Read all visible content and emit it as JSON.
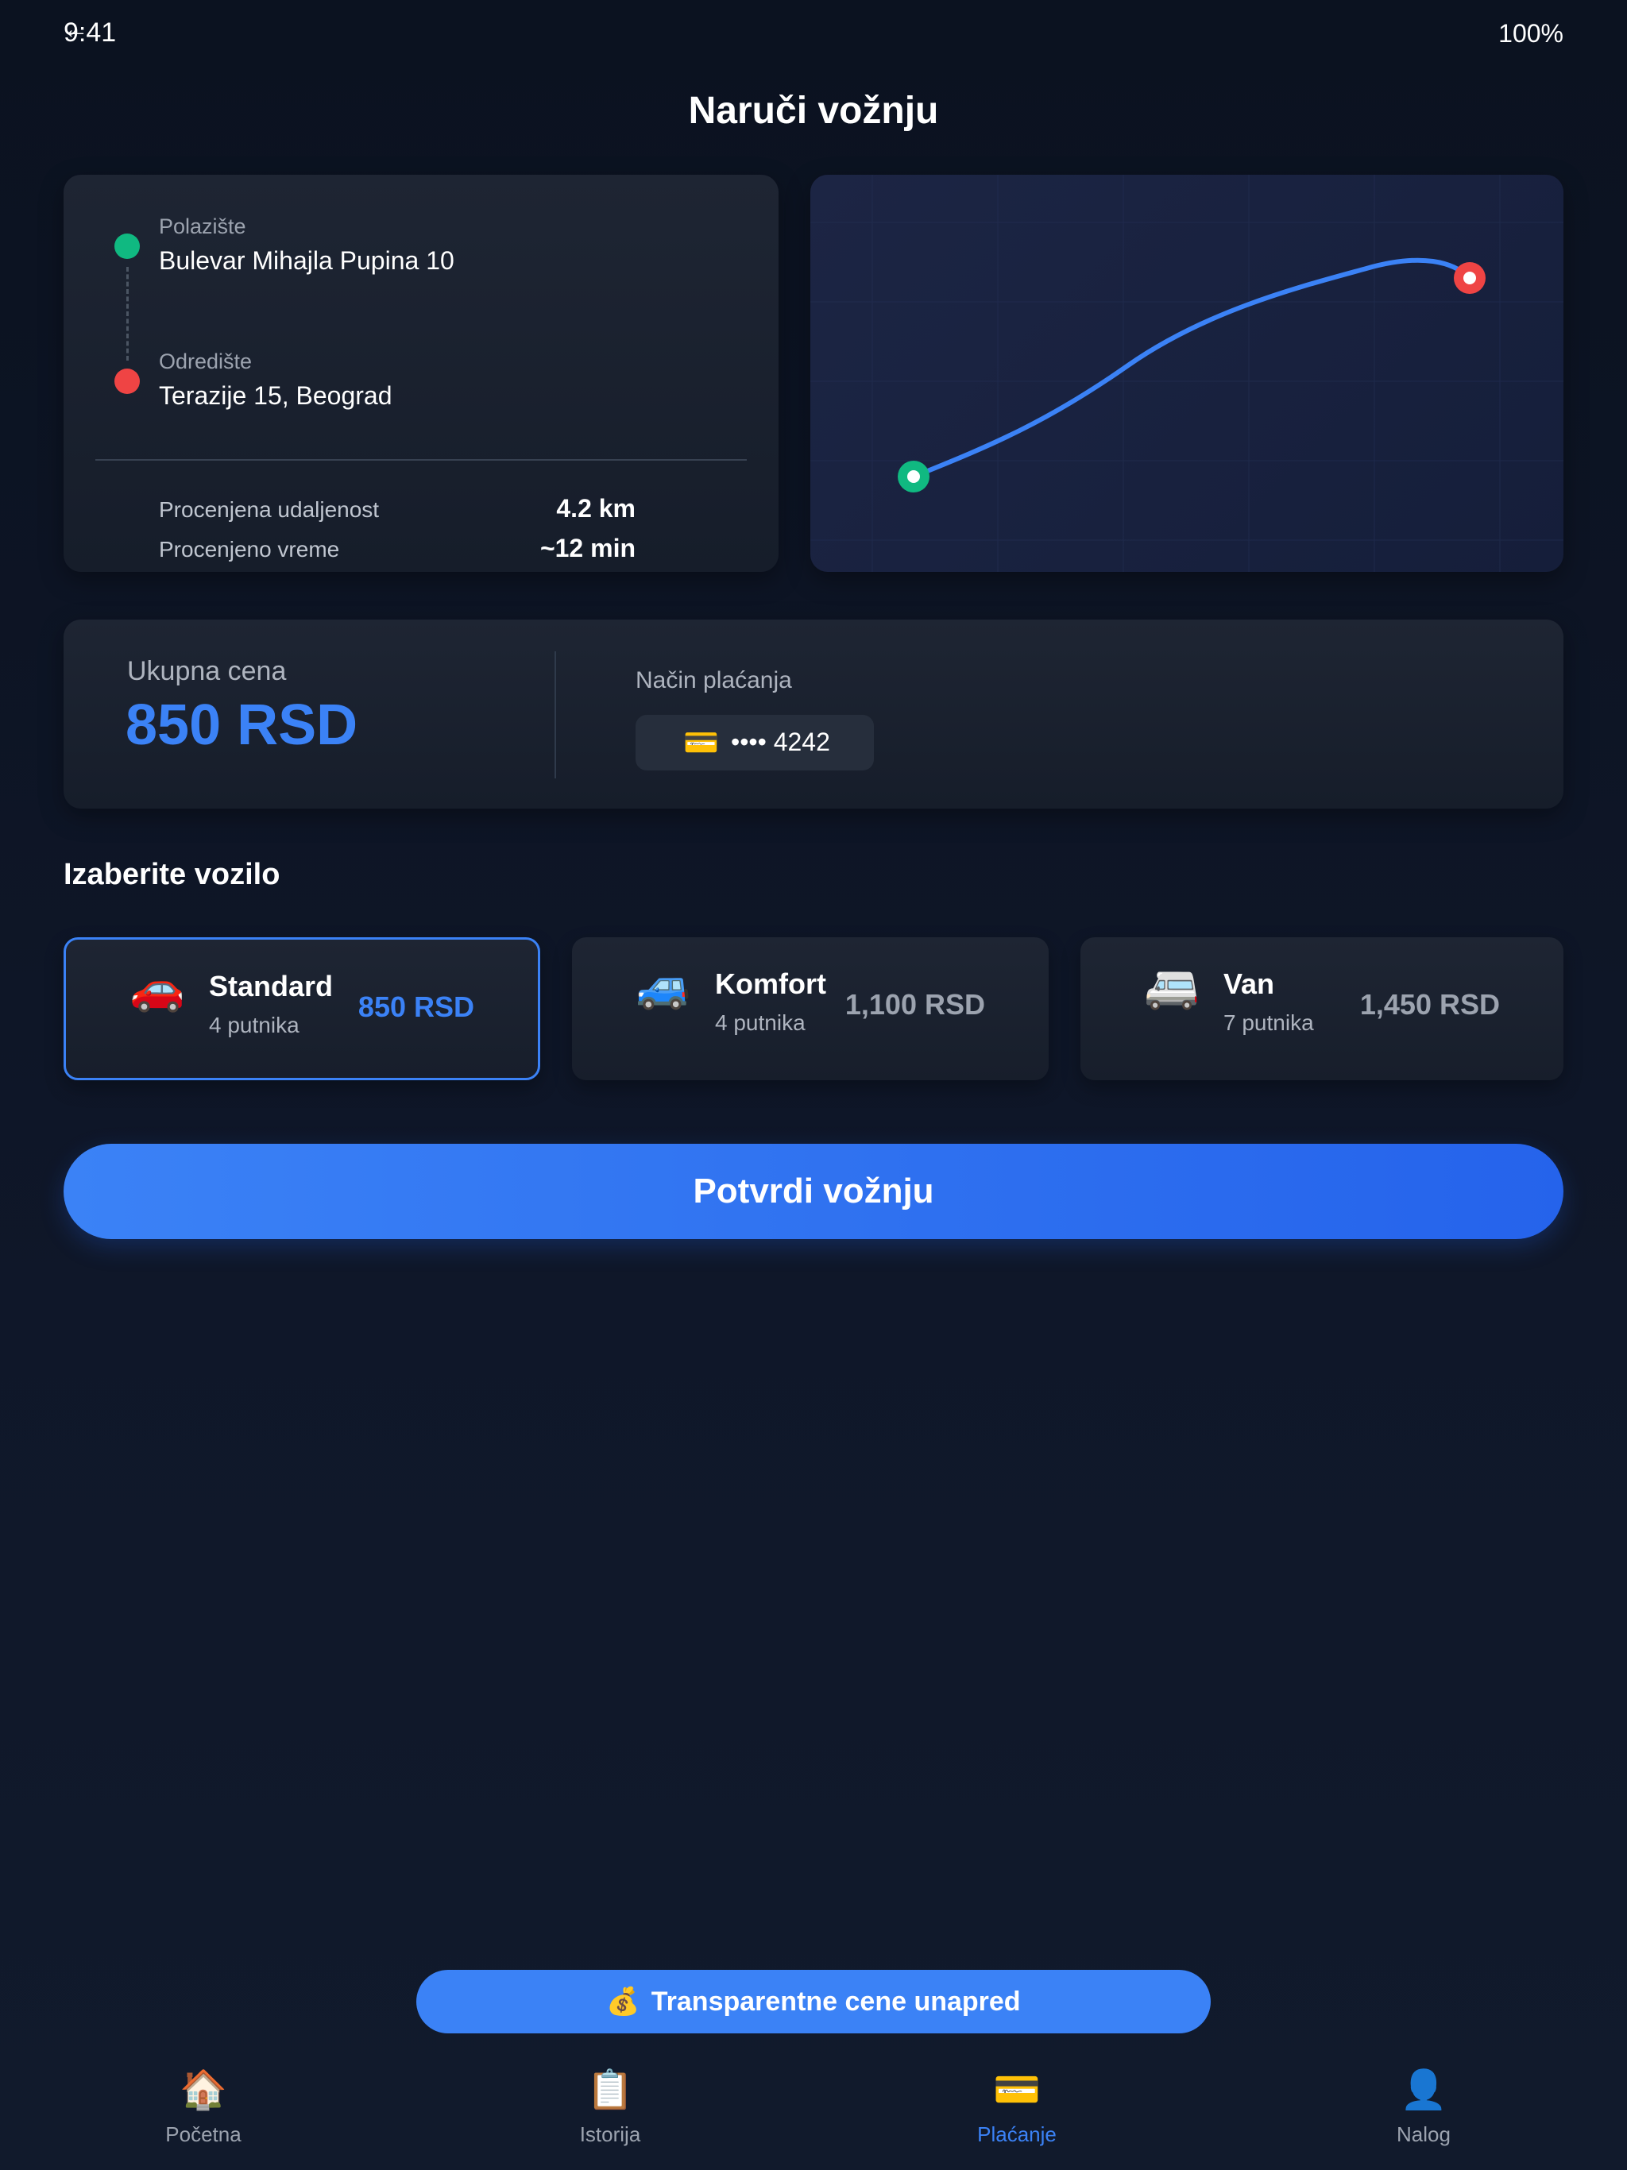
{
  "status": {
    "time": "9:41",
    "battery": "100%",
    "back_icon": "back-arrow-icon"
  },
  "header": {
    "title": "Naruči vožnju"
  },
  "route": {
    "origin_label": "Polazište",
    "origin_value": "Bulevar Mihajla Pupina 10",
    "destination_label": "Odredište",
    "destination_value": "Terazije 15, Beograd",
    "distance_label": "Procenjena udaljenost",
    "distance_value": "4.2 km",
    "time_label": "Procenjeno vreme",
    "time_value": "~12 min"
  },
  "price": {
    "label": "Ukupna cena",
    "value": "850 RSD"
  },
  "payment": {
    "label": "Način plaćanja",
    "card_icon": "💳",
    "card_number": "•••• 4242"
  },
  "vehicles": {
    "title": "Izaberite vozilo",
    "items": [
      {
        "icon": "🚗",
        "name": "Standard",
        "seats": "4 putnika",
        "price": "850 RSD",
        "selected": true
      },
      {
        "icon": "🚙",
        "name": "Komfort",
        "seats": "4 putnika",
        "price": "1,100 RSD",
        "selected": false
      },
      {
        "icon": "🚐",
        "name": "Van",
        "seats": "7 putnika",
        "price": "1,450 RSD",
        "selected": false
      }
    ]
  },
  "confirm_label": "Potvrdi vožnju",
  "promo": {
    "icon": "💰",
    "text": "Transparentne cene unapred"
  },
  "tabs": [
    {
      "icon": "🏠",
      "label": "Početna",
      "active": false
    },
    {
      "icon": "📋",
      "label": "Istorija",
      "active": false
    },
    {
      "icon": "💳",
      "label": "Plaćanje",
      "active": true
    },
    {
      "icon": "👤",
      "label": "Nalog",
      "active": false
    }
  ],
  "colors": {
    "accent": "#3b82f6",
    "origin": "#10b981",
    "destination": "#ef4444",
    "background": "#0f1728"
  }
}
